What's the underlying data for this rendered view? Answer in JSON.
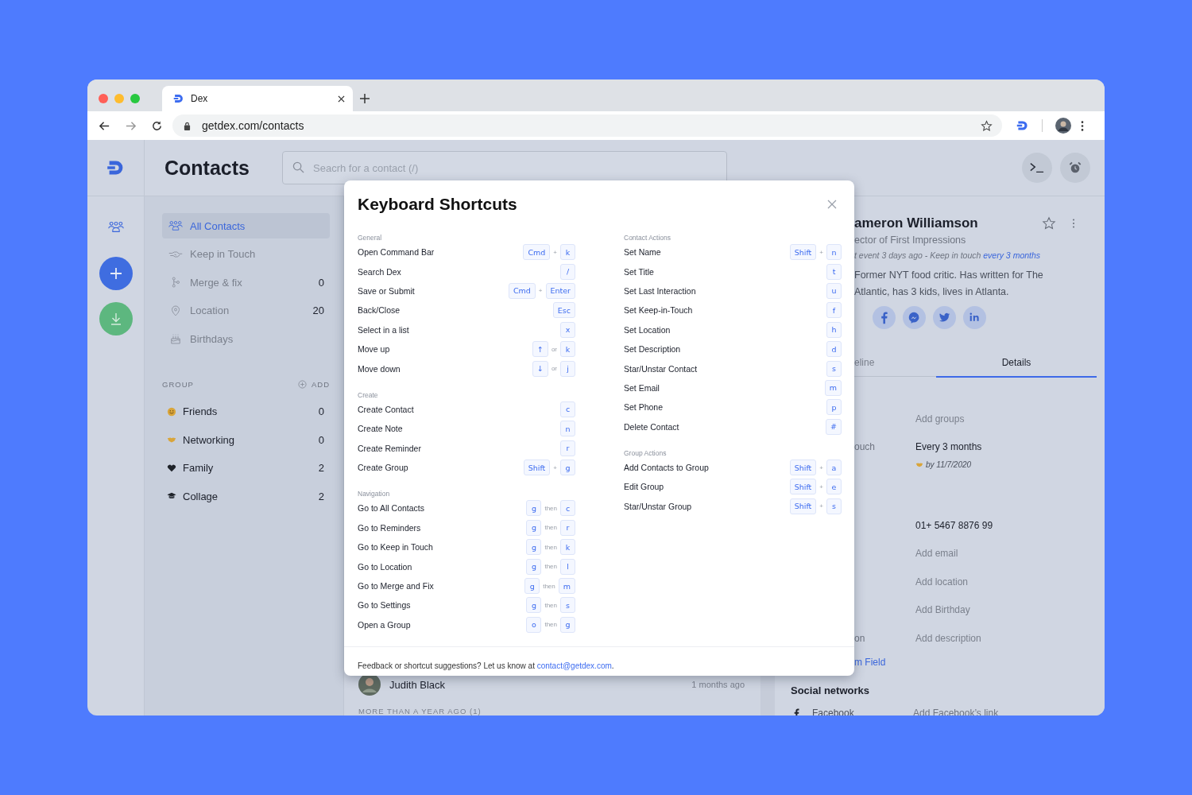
{
  "browser": {
    "tab_title": "Dex",
    "url": "getdex.com/contacts"
  },
  "header": {
    "title": "Contacts",
    "search": {
      "placeholder": "Seacrh for a contact (/)"
    }
  },
  "sidebar": {
    "items": [
      {
        "label": "All Contacts",
        "selected": true
      },
      {
        "label": "Keep in Touch",
        "selected": false
      },
      {
        "label": "Merge & fix",
        "count": "0",
        "selected": false
      },
      {
        "label": "Location",
        "count": "20",
        "selected": false
      },
      {
        "label": "Birthdays",
        "selected": false
      }
    ],
    "group_heading": "GROUP",
    "add_label": "ADD",
    "groups": [
      {
        "name": "Friends",
        "count": "0"
      },
      {
        "name": "Networking",
        "count": "0"
      },
      {
        "name": "Family",
        "count": "2"
      },
      {
        "name": "Collage",
        "count": "2"
      }
    ]
  },
  "contact_list": {
    "rows": [
      {
        "name": "Judith Black",
        "time": "1 months ago"
      }
    ],
    "section": "MORE THAN A YEAR AGO (1)"
  },
  "contact": {
    "name": "ameron Williamson",
    "title": "ector of First Impressions",
    "meta": "t event 3 days ago - Keep in touch ",
    "meta_link": "every 3 months",
    "description": "Former NYT food critic. Has written for The Atlantic, has 3 kids, lives in Atlanta.",
    "tabs": [
      {
        "label": "eline",
        "selected": false
      },
      {
        "label": "Details",
        "selected": true
      }
    ],
    "details": [
      {
        "kind": "empty",
        "value": "Add groups"
      },
      {
        "kind": "filled",
        "label": "ouch",
        "value": "Every 3 months"
      },
      {
        "kind": "note",
        "value": "by 11/7/2020"
      },
      {
        "kind": "filled",
        "value": "01+ 5467 8876 99"
      },
      {
        "kind": "empty",
        "value": "Add email"
      },
      {
        "kind": "empty",
        "value": "Add location"
      },
      {
        "kind": "empty",
        "value": "Add Birthday"
      },
      {
        "kind": "empty",
        "label": "on",
        "value": "Add description"
      }
    ],
    "custom_field_link": "m Field",
    "social_heading": "Social networks",
    "social": [
      {
        "label": "Facebook",
        "value": "Add Facebook’s link"
      }
    ]
  },
  "modal": {
    "title": "Keyboard Shortcuts",
    "columns": [
      {
        "sections": [
          {
            "title": "General",
            "shortcuts": [
              {
                "action": "Open Command Bar",
                "keys": [
                  {
                    "kind": "key",
                    "text": "Cmd"
                  },
                  {
                    "kind": "joiner",
                    "text": "+"
                  },
                  {
                    "kind": "key",
                    "text": "k"
                  }
                ]
              },
              {
                "action": "Search Dex",
                "keys": [
                  {
                    "kind": "key",
                    "text": "/"
                  }
                ]
              },
              {
                "action": "Save or Submit",
                "keys": [
                  {
                    "kind": "key",
                    "text": "Cmd"
                  },
                  {
                    "kind": "joiner",
                    "text": "+"
                  },
                  {
                    "kind": "key",
                    "text": "Enter"
                  }
                ]
              },
              {
                "action": "Back/Close",
                "keys": [
                  {
                    "kind": "key",
                    "text": "Esc"
                  }
                ]
              },
              {
                "action": "Select in a list",
                "keys": [
                  {
                    "kind": "key",
                    "text": "x"
                  }
                ]
              },
              {
                "action": "Move up",
                "keys": [
                  {
                    "kind": "key",
                    "text": "↑"
                  },
                  {
                    "kind": "joiner",
                    "text": "or"
                  },
                  {
                    "kind": "key",
                    "text": "k"
                  }
                ]
              },
              {
                "action": "Move down",
                "keys": [
                  {
                    "kind": "key",
                    "text": "↓"
                  },
                  {
                    "kind": "joiner",
                    "text": "or"
                  },
                  {
                    "kind": "key",
                    "text": "j"
                  }
                ]
              }
            ]
          },
          {
            "title": "Create",
            "shortcuts": [
              {
                "action": "Create Contact",
                "keys": [
                  {
                    "kind": "key",
                    "text": "c"
                  }
                ]
              },
              {
                "action": "Create Note",
                "keys": [
                  {
                    "kind": "key",
                    "text": "n"
                  }
                ]
              },
              {
                "action": "Create Reminder",
                "keys": [
                  {
                    "kind": "key",
                    "text": "r"
                  }
                ]
              },
              {
                "action": "Create Group",
                "keys": [
                  {
                    "kind": "key",
                    "text": "Shift"
                  },
                  {
                    "kind": "joiner",
                    "text": "+"
                  },
                  {
                    "kind": "key",
                    "text": "g"
                  }
                ]
              }
            ]
          },
          {
            "title": "Navigation",
            "shortcuts": [
              {
                "action": "Go to All Contacts",
                "keys": [
                  {
                    "kind": "key",
                    "text": "g"
                  },
                  {
                    "kind": "joiner",
                    "text": "then"
                  },
                  {
                    "kind": "key",
                    "text": "c"
                  }
                ]
              },
              {
                "action": "Go to Reminders",
                "keys": [
                  {
                    "kind": "key",
                    "text": "g"
                  },
                  {
                    "kind": "joiner",
                    "text": "then"
                  },
                  {
                    "kind": "key",
                    "text": "r"
                  }
                ]
              },
              {
                "action": "Go to Keep in Touch",
                "keys": [
                  {
                    "kind": "key",
                    "text": "g"
                  },
                  {
                    "kind": "joiner",
                    "text": "then"
                  },
                  {
                    "kind": "key",
                    "text": "k"
                  }
                ]
              },
              {
                "action": "Go to Location",
                "keys": [
                  {
                    "kind": "key",
                    "text": "g"
                  },
                  {
                    "kind": "joiner",
                    "text": "then"
                  },
                  {
                    "kind": "key",
                    "text": "l"
                  }
                ]
              },
              {
                "action": "Go to Merge and Fix",
                "keys": [
                  {
                    "kind": "key",
                    "text": "g"
                  },
                  {
                    "kind": "joiner",
                    "text": "then"
                  },
                  {
                    "kind": "key",
                    "text": "m"
                  }
                ]
              },
              {
                "action": "Go to Settings",
                "keys": [
                  {
                    "kind": "key",
                    "text": "g"
                  },
                  {
                    "kind": "joiner",
                    "text": "then"
                  },
                  {
                    "kind": "key",
                    "text": "s"
                  }
                ]
              },
              {
                "action": "Open a Group",
                "keys": [
                  {
                    "kind": "key",
                    "text": "o"
                  },
                  {
                    "kind": "joiner",
                    "text": "then"
                  },
                  {
                    "kind": "key",
                    "text": "g"
                  }
                ]
              }
            ]
          }
        ]
      },
      {
        "sections": [
          {
            "title": "Contact Actions",
            "shortcuts": [
              {
                "action": "Set Name",
                "keys": [
                  {
                    "kind": "key",
                    "text": "Shift"
                  },
                  {
                    "kind": "joiner",
                    "text": "+"
                  },
                  {
                    "kind": "key",
                    "text": "n"
                  }
                ]
              },
              {
                "action": "Set Title",
                "keys": [
                  {
                    "kind": "key",
                    "text": "t"
                  }
                ]
              },
              {
                "action": "Set Last Interaction",
                "keys": [
                  {
                    "kind": "key",
                    "text": "u"
                  }
                ]
              },
              {
                "action": "Set Keep-in-Touch",
                "keys": [
                  {
                    "kind": "key",
                    "text": "f"
                  }
                ]
              },
              {
                "action": "Set Location",
                "keys": [
                  {
                    "kind": "key",
                    "text": "h"
                  }
                ]
              },
              {
                "action": "Set Description",
                "keys": [
                  {
                    "kind": "key",
                    "text": "d"
                  }
                ]
              },
              {
                "action": "Star/Unstar Contact",
                "keys": [
                  {
                    "kind": "key",
                    "text": "s"
                  }
                ]
              },
              {
                "action": "Set Email",
                "keys": [
                  {
                    "kind": "key",
                    "text": "m"
                  }
                ]
              },
              {
                "action": "Set Phone",
                "keys": [
                  {
                    "kind": "key",
                    "text": "p"
                  }
                ]
              },
              {
                "action": "Delete Contact",
                "keys": [
                  {
                    "kind": "key",
                    "text": "#"
                  }
                ]
              }
            ]
          },
          {
            "title": "Group Actions",
            "shortcuts": [
              {
                "action": "Add Contacts to Group",
                "keys": [
                  {
                    "kind": "key",
                    "text": "Shift"
                  },
                  {
                    "kind": "joiner",
                    "text": "+"
                  },
                  {
                    "kind": "key",
                    "text": "a"
                  }
                ]
              },
              {
                "action": "Edit Group",
                "keys": [
                  {
                    "kind": "key",
                    "text": "Shift"
                  },
                  {
                    "kind": "joiner",
                    "text": "+"
                  },
                  {
                    "kind": "key",
                    "text": "e"
                  }
                ]
              },
              {
                "action": "Star/Unstar Group",
                "keys": [
                  {
                    "kind": "key",
                    "text": "Shift"
                  },
                  {
                    "kind": "joiner",
                    "text": "+"
                  },
                  {
                    "kind": "key",
                    "text": "s"
                  }
                ]
              }
            ]
          }
        ]
      }
    ],
    "footer": {
      "text": "Feedback or shortcut suggestions? Let us know at ",
      "link": "contact@getdex.com",
      "after": "."
    }
  }
}
